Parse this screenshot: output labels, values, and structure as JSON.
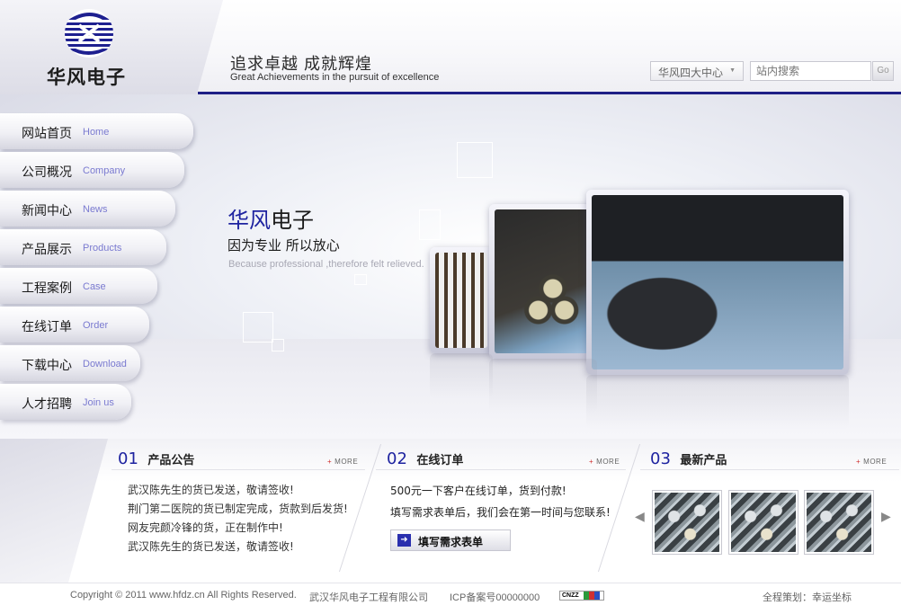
{
  "brand": {
    "logo_text": "华风电子",
    "slogan_cn": "追求卓越   成就辉煌",
    "slogan_en": "Great Achievements in the pursuit of excellence"
  },
  "header": {
    "center_select": "华风四大中心",
    "search_placeholder": "站内搜索",
    "search_button": "Go"
  },
  "nav": {
    "items": [
      {
        "cn": "网站首页",
        "en": "Home"
      },
      {
        "cn": "公司概况",
        "en": "Company"
      },
      {
        "cn": "新闻中心",
        "en": "News"
      },
      {
        "cn": "产品展示",
        "en": "Products"
      },
      {
        "cn": "工程案例",
        "en": "Case"
      },
      {
        "cn": "在线订单",
        "en": "Order"
      },
      {
        "cn": "下载中心",
        "en": "Download"
      },
      {
        "cn": "人才招聘",
        "en": "Join us"
      }
    ]
  },
  "banner": {
    "title_highlight": "华风",
    "title_rest": "电子",
    "subtitle": "因为专业 所以放心",
    "subtitle_en": "Because professional ,therefore felt relieved."
  },
  "panels": {
    "notice": {
      "num": "01",
      "title": "产品公告",
      "more": "MORE",
      "items": [
        "武汉陈先生的货已发送，敬请签收!",
        "荆门第二医院的货已制定完成，货款到后发货!",
        "网友完颜冷锋的货，正在制作中!",
        "武汉陈先生的货已发送，敬请签收!"
      ]
    },
    "order": {
      "num": "02",
      "title": "在线订单",
      "more": "MORE",
      "line1": "500元一下客户在线订单，货到付款!",
      "line2": "填写需求表单后，我们会在第一时间与您联系!",
      "button": "填写需求表单"
    },
    "products": {
      "num": "03",
      "title": "最新产品",
      "more": "MORE",
      "prev": "◀",
      "next": "▶"
    }
  },
  "footer": {
    "copyright": "Copyright © 2011 www.hfdz.cn All Rights Reserved.",
    "company": "武汉华风电子工程有限公司",
    "icp": "ICP备案号00000000",
    "cnzz": "CNZZ",
    "credit": "全程策划：幸运坐标"
  },
  "colors": {
    "brand_blue": "#1e23a0",
    "nav_en": "#7a7ad0",
    "more_plus": "#d03030"
  }
}
